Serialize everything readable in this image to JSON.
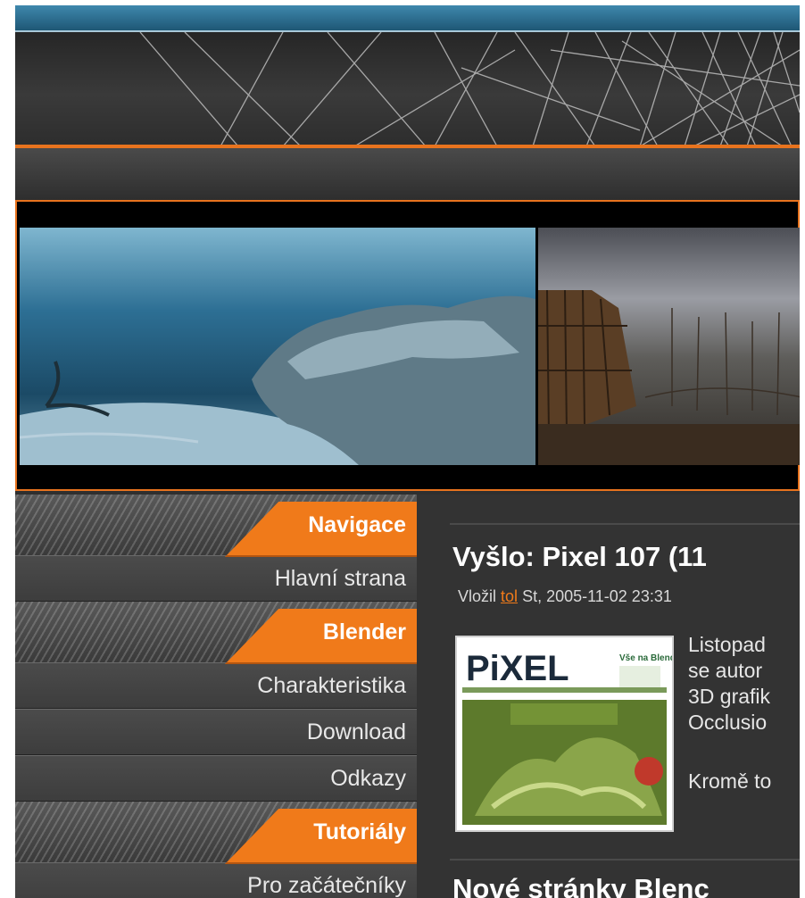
{
  "colors": {
    "accent": "#f07a1a",
    "topbar": "#2c6f93",
    "page": "#2f2f2f"
  },
  "sidebar": {
    "sections": [
      {
        "title": "Navigace",
        "links": [
          "Hlavní strana"
        ]
      },
      {
        "title": "Blender",
        "links": [
          "Charakteristika",
          "Download",
          "Odkazy"
        ]
      },
      {
        "title": "Tutoriály",
        "links": [
          "Pro začátečníky"
        ]
      }
    ]
  },
  "article": {
    "title": "Vyšlo: Pixel 107 (11",
    "byline_prefix": "Vložil",
    "author": "tol",
    "byline_date": "St, 2005-11-02 23:31",
    "cover": {
      "logo": "PiXEL",
      "side_text": "Vše na Blender"
    },
    "body_lines": [
      "Listopad",
      "se autor",
      "3D grafik",
      "Occlusio"
    ],
    "body_line2": "Kromě to"
  },
  "article2": {
    "title": "Nové stránky Blenc"
  }
}
